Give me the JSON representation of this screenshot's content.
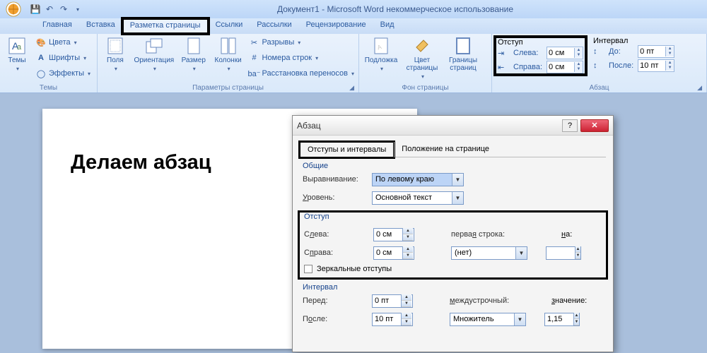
{
  "title": "Документ1 - Microsoft Word некоммерческое использование",
  "tabs": {
    "home": "Главная",
    "insert": "Вставка",
    "layout": "Разметка страницы",
    "refs": "Ссылки",
    "mail": "Рассылки",
    "review": "Рецензирование",
    "view": "Вид"
  },
  "grp": {
    "themes": {
      "label": "Темы",
      "themes": "Темы",
      "colors": "Цвета",
      "fonts": "Шрифты",
      "effects": "Эффекты"
    },
    "page_setup": {
      "label": "Параметры страницы",
      "margins": "Поля",
      "orient": "Ориентация",
      "size": "Размер",
      "columns": "Колонки",
      "breaks": "Разрывы",
      "lines": "Номера строк",
      "hyphen": "Расстановка переносов"
    },
    "bg": {
      "label": "Фон страницы",
      "watermark": "Подложка",
      "color": "Цвет страницы",
      "borders": "Границы страниц"
    },
    "para": {
      "label": "Абзац",
      "indent_hdr": "Отступ",
      "interval_hdr": "Интервал",
      "left": "Слева:",
      "right": "Справа:",
      "before": "До:",
      "after": "После:",
      "left_v": "0 см",
      "right_v": "0 см",
      "before_v": "0 пт",
      "after_v": "10 пт"
    }
  },
  "doc": {
    "heading": "Делаем абзац"
  },
  "dlg": {
    "title": "Абзац",
    "tab1": "Отступы и интервалы",
    "tab2": "Положение на странице",
    "general": "Общие",
    "align_lbl": "Выравнивание:",
    "align_v": "По левому краю",
    "level_lbl": "Уровень:",
    "level_v": "Основной текст",
    "indent": "Отступ",
    "left": "Слева:",
    "right": "Справа:",
    "left_v": "0 см",
    "right_v": "0 см",
    "first": "первая строка:",
    "first_v": "(нет)",
    "by": "на:",
    "mirror": "Зеркальные отступы",
    "interval": "Интервал",
    "before": "Перед:",
    "after": "После:",
    "before_v": "0 пт",
    "after_v": "10 пт",
    "linesp": "междустрочный:",
    "linesp_v": "Множитель",
    "val_lbl": "значение:",
    "val_v": "1,15"
  }
}
